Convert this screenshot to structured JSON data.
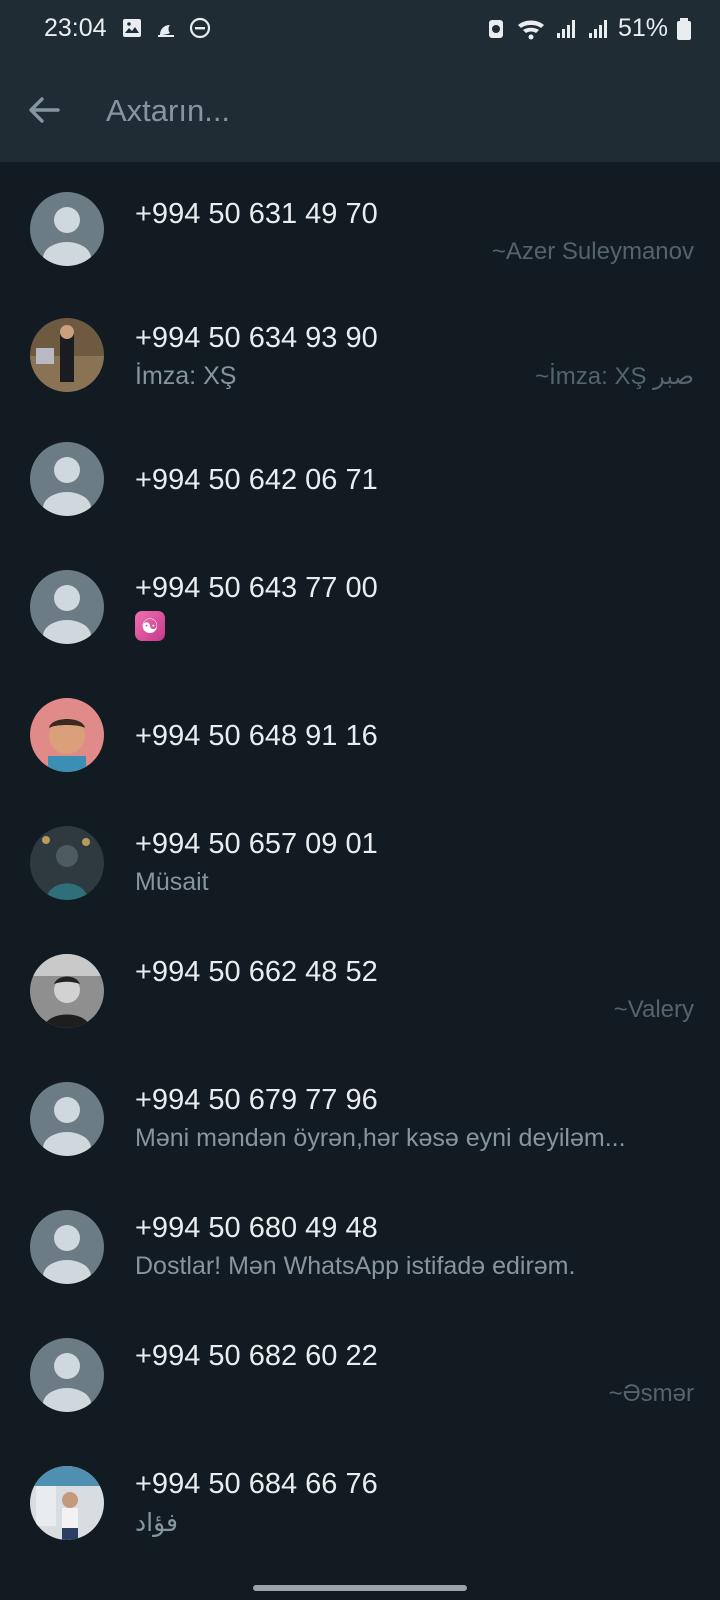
{
  "status_bar": {
    "time": "23:04",
    "battery": "51%",
    "icons": [
      "gallery-icon",
      "moon-icon",
      "do-not-disturb-icon",
      "battery-saver-icon",
      "wifi-icon",
      "signal-icon",
      "signal-icon",
      "battery-icon"
    ]
  },
  "toolbar": {
    "search_placeholder": "Axtarın..."
  },
  "colors": {
    "background": "#111b21",
    "toolbar": "#1f2c34",
    "primary_text": "#e9edef",
    "secondary_text": "#8696a0"
  },
  "contacts": [
    {
      "name": "+994 50 631 49 70",
      "about": "",
      "pushname": "~Azer Suleymanov",
      "avatar": "default"
    },
    {
      "name": "+994 50 634 93 90",
      "about": "İmza: XŞ",
      "pushname": "~İmza: XŞ صبر",
      "avatar": "photo"
    },
    {
      "name": "+994 50 642 06 71",
      "about": "",
      "pushname": "",
      "avatar": "default"
    },
    {
      "name": "+994 50 643 77 00",
      "about": "☯",
      "pushname": "",
      "avatar": "default"
    },
    {
      "name": "+994 50 648 91 16",
      "about": "",
      "pushname": "",
      "avatar": "photo"
    },
    {
      "name": "+994 50 657 09 01",
      "about": "Müsait",
      "pushname": "",
      "avatar": "photo"
    },
    {
      "name": "+994 50 662 48 52",
      "about": "",
      "pushname": "~Valery",
      "avatar": "photo"
    },
    {
      "name": "+994 50 679 77 96",
      "about": "Məni məndən öyrən,hər kəsə eyni deyiləm...",
      "pushname": "",
      "avatar": "default"
    },
    {
      "name": "+994 50 680 49 48",
      "about": "Dostlar! Mən WhatsApp istifadə edirəm.",
      "pushname": "",
      "avatar": "default"
    },
    {
      "name": "+994 50 682 60 22",
      "about": "",
      "pushname": "~Əsmər",
      "avatar": "default"
    },
    {
      "name": "+994 50 684 66 76",
      "about": "فؤاد",
      "pushname": "",
      "avatar": "photo"
    }
  ]
}
